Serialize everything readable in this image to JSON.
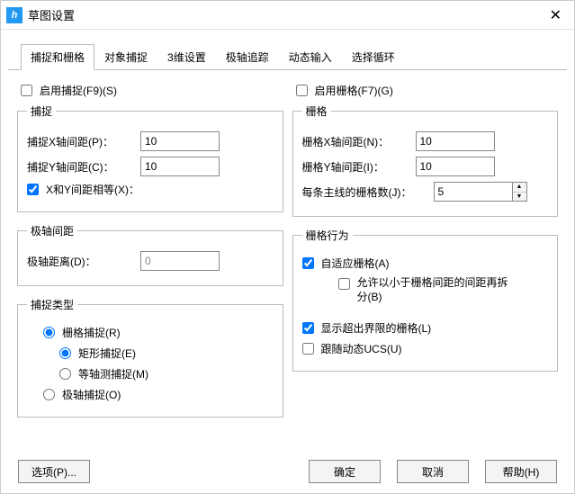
{
  "title": "草图设置",
  "tabs": [
    "捕捉和栅格",
    "对象捕捉",
    "3维设置",
    "极轴追踪",
    "动态输入",
    "选择循环"
  ],
  "active_tab": 0,
  "left": {
    "enable_snap": "启用捕捉(F9)(S)",
    "snap_group": "捕捉",
    "snap_x_label": "捕捉X轴间距(P)：",
    "snap_x_value": "10",
    "snap_y_label": "捕捉Y轴间距(C)：",
    "snap_y_value": "10",
    "xy_equal": "X和Y间距相等(X)：",
    "polar_spacing_group": "极轴间距",
    "polar_dist_label": "极轴距离(D)：",
    "polar_dist_value": "0",
    "snap_type_group": "捕捉类型",
    "grid_snap": "栅格捕捉(R)",
    "rect_snap": "矩形捕捉(E)",
    "iso_snap": "等轴测捕捉(M)",
    "polar_snap": "极轴捕捉(O)"
  },
  "right": {
    "enable_grid": "启用栅格(F7)(G)",
    "grid_group": "栅格",
    "grid_x_label": "栅格X轴间距(N)：",
    "grid_x_value": "10",
    "grid_y_label": "栅格Y轴间距(I)：",
    "grid_y_value": "10",
    "grids_per_major_label": "每条主线的栅格数(J)：",
    "grids_per_major_value": "5",
    "grid_behavior_group": "栅格行为",
    "adaptive_grid": "自适应栅格(A)",
    "allow_subsplit": "允许以小于栅格间距的间距再拆分(B)",
    "show_beyond_limits": "显示超出界限的栅格(L)",
    "follow_ucs": "跟随动态UCS(U)"
  },
  "footer": {
    "options": "选项(P)...",
    "ok": "确定",
    "cancel": "取消",
    "help": "帮助(H)"
  }
}
